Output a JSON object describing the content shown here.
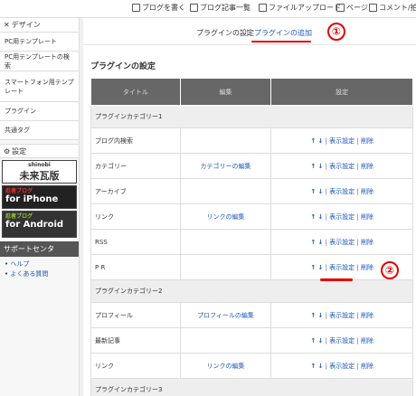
{
  "topbar": {
    "items": [
      {
        "label": "ブログを書く"
      },
      {
        "label": "ブログ記事一覧"
      },
      {
        "label": "ファイルアップロード"
      },
      {
        "label": "ページ"
      },
      {
        "label": "コメント/拍手"
      }
    ]
  },
  "sidebar": {
    "design_label": "デザイン",
    "items": [
      {
        "label": "PC用テンプレート"
      },
      {
        "label": "PC用テンプレートの検索"
      },
      {
        "label": "スマートフォン用テンプレート"
      },
      {
        "label": "プラグイン"
      },
      {
        "label": "共通タグ"
      }
    ],
    "settings_label": "設定",
    "banner_shinobi_top": "shinobi",
    "banner_shinobi": "未来瓦版",
    "banner_iphone_top": "忍者ブログ",
    "banner_iphone": "for iPhone",
    "banner_android_top": "忍者ブログ",
    "banner_android": "for Android",
    "support_title": "サポートセンタ",
    "support_links": [
      {
        "label": "ヘルプ"
      },
      {
        "label": "よくある質問"
      }
    ]
  },
  "main": {
    "tab_current": "プラグインの設定",
    "tab_separator": "|",
    "tab_add": "プラグインの追加",
    "annotation_1": "①",
    "annotation_2": "②",
    "section_title": "プラグインの設定",
    "columns": [
      "タイトル",
      "編集",
      "設定"
    ],
    "ops": {
      "up": "↑",
      "down": "↓",
      "display": "表示設定",
      "delete": "削除",
      "sep": "|"
    },
    "rows": [
      {
        "type": "category",
        "name": "プラグインカテゴリー1"
      },
      {
        "type": "plugin",
        "name": "ブログ内検索",
        "edit": ""
      },
      {
        "type": "plugin",
        "name": "カテゴリー",
        "edit": "カテゴリーの編集"
      },
      {
        "type": "plugin",
        "name": "アーカイブ",
        "edit": ""
      },
      {
        "type": "plugin",
        "name": "リンク",
        "edit": "リンクの編集"
      },
      {
        "type": "plugin",
        "name": "RSS",
        "edit": ""
      },
      {
        "type": "plugin",
        "name": "P R",
        "edit": ""
      },
      {
        "type": "category",
        "name": "プラグインカテゴリー2"
      },
      {
        "type": "plugin",
        "name": "プロフィール",
        "edit": "プロフィールの編集"
      },
      {
        "type": "plugin",
        "name": "最新記事",
        "edit": ""
      },
      {
        "type": "plugin",
        "name": "リンク",
        "edit": "リンクの編集"
      },
      {
        "type": "category",
        "name": "プラグインカテゴリー3"
      }
    ]
  }
}
